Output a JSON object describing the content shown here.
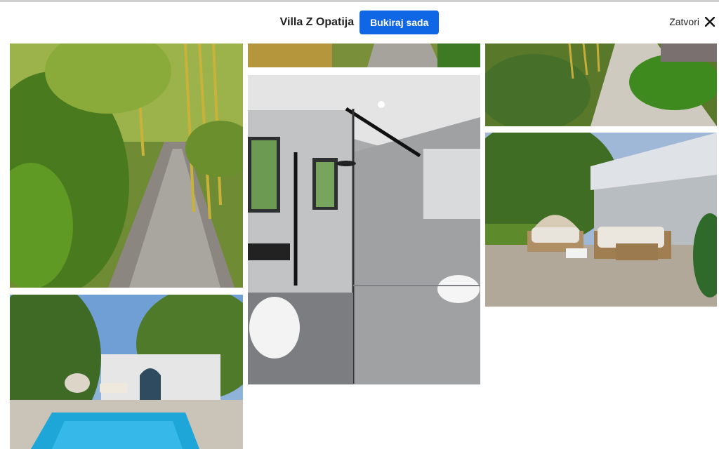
{
  "header": {
    "title": "Villa Z Opatija",
    "book_label": "Bukiraj sada",
    "close_label": "Zatvori"
  },
  "colors": {
    "accent": "#1067e6",
    "pool": "#1fa6d9",
    "foliage": "#3d7a1f"
  },
  "gallery": {
    "photos": [
      {
        "name": "garden-path-photo",
        "subject": "bamboo garden stone path"
      },
      {
        "name": "pool-house-photo",
        "subject": "pool and garden house"
      },
      {
        "name": "path-strip-photo",
        "subject": "garden path"
      },
      {
        "name": "bathroom-photo",
        "subject": "bathroom with glass shower"
      },
      {
        "name": "garden-terrace-photo",
        "subject": "garden path with plants"
      },
      {
        "name": "patio-lounge-photo",
        "subject": "patio with outdoor sofas"
      }
    ]
  }
}
